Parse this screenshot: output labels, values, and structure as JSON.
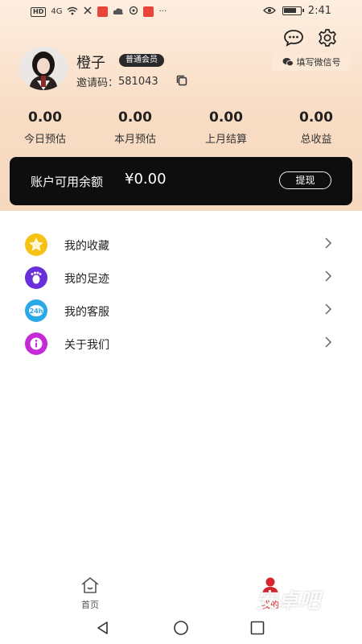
{
  "status_bar": {
    "hd": "HD",
    "signal": "4G",
    "time": "2:41"
  },
  "header": {
    "wechat_label": "填写微信号"
  },
  "profile": {
    "username": "橙子",
    "member_badge": "普通会员",
    "invite_label": "邀请码：",
    "invite_code": "581043"
  },
  "stats": [
    {
      "value": "0.00",
      "label": "今日预估"
    },
    {
      "value": "0.00",
      "label": "本月预估"
    },
    {
      "value": "0.00",
      "label": "上月结算"
    },
    {
      "value": "0.00",
      "label": "总收益"
    }
  ],
  "balance": {
    "label": "账户可用余额",
    "amount": "¥0.00",
    "withdraw_label": "提现"
  },
  "menu": [
    {
      "label": "我的收藏",
      "icon": "star-icon",
      "color": "#f6c315"
    },
    {
      "label": "我的足迹",
      "icon": "footprint-icon",
      "color": "#6a2fd8"
    },
    {
      "label": "我的客服",
      "icon": "customer-service-icon",
      "color": "#2aa8e8"
    },
    {
      "label": "关于我们",
      "icon": "info-icon",
      "color": "#c42bd6"
    }
  ],
  "tabbar": {
    "home_label": "首页",
    "mine_label": "我的"
  },
  "watermark": "安卓吧",
  "colors": {
    "accent_red": "#d4242c",
    "card_black": "#0e0e0e",
    "header_peach": "#f8dcc4"
  }
}
